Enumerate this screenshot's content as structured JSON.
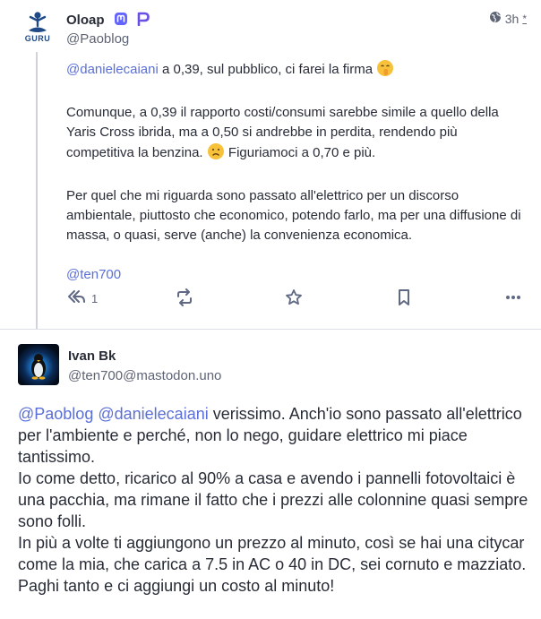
{
  "post1": {
    "display_name": "Oloap",
    "handle": "@Paoblog",
    "avatar_text": "GURU",
    "time": "3h",
    "visibility": "public",
    "mention_first": "@danielecaiani",
    "para1_text": " a 0,39, sul pubblico, ci farei la firma",
    "para2_text_a": "Comunque, a 0,39 il rapporto costi/consumi sarebbe simile a quello della Yaris Cross ibrida, ma a 0,50 si andrebbe in perdita, rendendo più competitiva la benzina.",
    "para2_text_b": " Figuriamoci a 0,70 e più.",
    "para3_text": "Per quel che mi riguarda sono passato all'elettrico per un discorso ambientale, piuttosto che economico, potendo farlo, ma per una diffusione di massa, o quasi, serve (anche) la convenienza economica.",
    "mention_last": "@ten700",
    "reply_count": "1"
  },
  "post2": {
    "display_name": "Ivan Bk",
    "handle": "@ten700@mastodon.uno",
    "mention1": "@Paoblog",
    "mention2": "@danielecaiani",
    "line1_text": " verissimo. Anch'io sono passato all'elettrico per l'ambiente e perché, non lo nego, guidare elettrico mi piace tantissimo.",
    "line2_text": "Io come detto, ricarico al 90% a casa e avendo i pannelli fotovoltaici è una pacchia, ma rimane il fatto che i prezzi alle colonnine quasi sempre sono folli.",
    "line3_text": "In più a volte ti aggiungono un prezzo al minuto, così se hai una citycar come la mia, che carica a 7.5 in AC o 40 in DC, sei cornuto e mazziato. Paghi tanto e ci aggiungi un costo al minuto!"
  },
  "colors": {
    "mention": "#5b6fd6",
    "text": "#282c37",
    "muted": "#606984"
  }
}
